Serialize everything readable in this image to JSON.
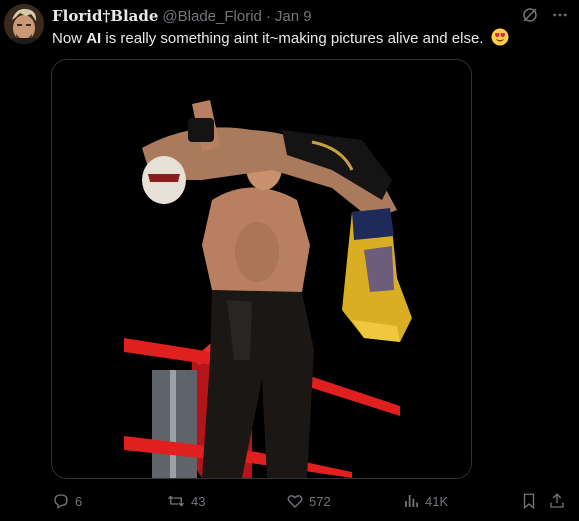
{
  "tweet": {
    "display_name": "Florid†Blade",
    "handle": "@Blade_Florid",
    "separator": "·",
    "date": "Jan 9",
    "text_before": "Now ",
    "text_bold": "AI",
    "text_after": " is really something aint it~making pictures alive and else.",
    "emoji": "smiling-face-with-heart-eyes"
  },
  "header_icons": [
    "grok-icon",
    "more-icon"
  ],
  "actions": {
    "replies": "6",
    "reposts": "43",
    "likes": "572",
    "views": "41K"
  },
  "colors": {
    "background": "#000000",
    "text": "#e7e9ea",
    "muted": "#71767b",
    "border": "#2f3336",
    "ring_rope": "#e0201e"
  }
}
